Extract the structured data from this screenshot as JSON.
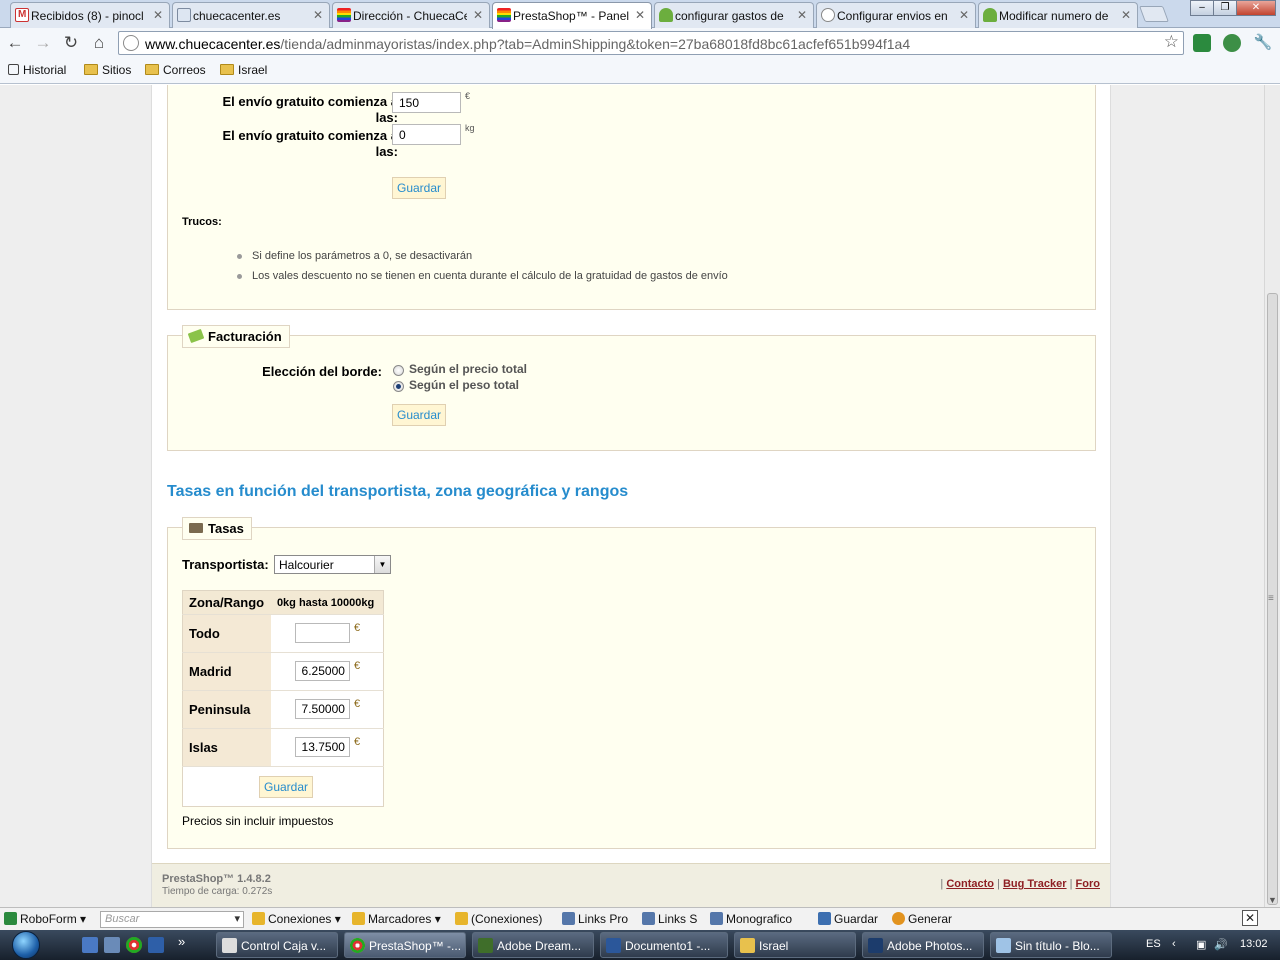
{
  "browser": {
    "tabs": [
      {
        "label": "Recibidos (8) - pinocl",
        "favicon": "gmail-icon",
        "active": false
      },
      {
        "label": "chuecacenter.es",
        "favicon": "page-icon",
        "active": false
      },
      {
        "label": "Dirección - ChuecaCe",
        "favicon": "rainbow-flag-icon",
        "active": false
      },
      {
        "label": "PrestaShop™ - Panel",
        "favicon": "rainbow-flag-icon",
        "active": true
      },
      {
        "label": "configurar gastos de",
        "favicon": "leaf-icon",
        "active": false
      },
      {
        "label": "Configurar envios en",
        "favicon": "globe-icon",
        "active": false
      },
      {
        "label": "Modificar numero de",
        "favicon": "leaf-icon",
        "active": false
      }
    ],
    "url_host": "www.chuecacenter.es",
    "url_path": "/tienda/adminmayoristas/index.php?tab=AdminShipping&token=27ba68018fd8bc61acfef651b994f1a4",
    "bookmarks": [
      "Historial",
      "Sitios",
      "Correos",
      "Israel"
    ]
  },
  "free_shipping": {
    "price_label": "El envío gratuito comienza a las:",
    "price_value": "150",
    "price_unit": "€",
    "weight_label": "El envío gratuito comienza a las:",
    "weight_value": "0",
    "weight_unit": "kg",
    "save_label": "Guardar",
    "tips_title": "Trucos:",
    "tips": [
      "Si define los parámetros a 0, se desactivarán",
      "Los vales descuento no se tienen en cuenta durante el cálculo de la gratuidad de gastos de envío"
    ]
  },
  "billing": {
    "legend": "Facturación",
    "label": "Elección del borde:",
    "options": [
      "Según el precio total",
      "Según el peso total"
    ],
    "selected_index": 1,
    "save_label": "Guardar"
  },
  "rates_section_title": "Tasas en función del transportista, zona geográfica y rangos",
  "rates": {
    "legend": "Tasas",
    "carrier_label": "Transportista:",
    "carrier_selected": "Halcourier",
    "table_headers": [
      "Zona/Rango",
      "0kg hasta 10000kg"
    ],
    "rows": [
      {
        "zone": "Todo",
        "value": "",
        "unit": "€"
      },
      {
        "zone": "Madrid",
        "value": "6.25000",
        "unit": "€"
      },
      {
        "zone": "Peninsula",
        "value": "7.50000",
        "unit": "€"
      },
      {
        "zone": "Islas",
        "value": "13.7500",
        "unit": "€"
      }
    ],
    "save_label": "Guardar",
    "note": "Precios sin incluir impuestos"
  },
  "footer": {
    "version": "PrestaShop™ 1.4.8.2",
    "load_time": "Tiempo de carga: 0.272s",
    "links": [
      "Contacto",
      "Bug Tracker",
      "Foro"
    ]
  },
  "roboform": {
    "name": "RoboForm",
    "search_placeholder": "Buscar",
    "items": [
      "Conexiones",
      "Marcadores",
      "(Conexiones)",
      "Links Pro",
      "Links S",
      "Monografico",
      "Guardar",
      "Generar"
    ]
  },
  "taskbar": {
    "tasks": [
      {
        "label": "Control Caja v...",
        "active": false
      },
      {
        "label": "PrestaShop™ -...",
        "active": true
      },
      {
        "label": "Adobe Dream...",
        "active": false
      },
      {
        "label": "Documento1 -...",
        "active": false
      },
      {
        "label": "Israel",
        "active": false
      },
      {
        "label": "Adobe Photos...",
        "active": false
      },
      {
        "label": "Sin título - Blo...",
        "active": false
      }
    ],
    "language": "ES",
    "clock": "13:02",
    "more_arrows": "»"
  },
  "colors": {
    "accent_blue": "#268ccd",
    "box_bg": "#fffff0",
    "box_border": "#dfd5c3",
    "footer_link": "#8e1f23"
  }
}
